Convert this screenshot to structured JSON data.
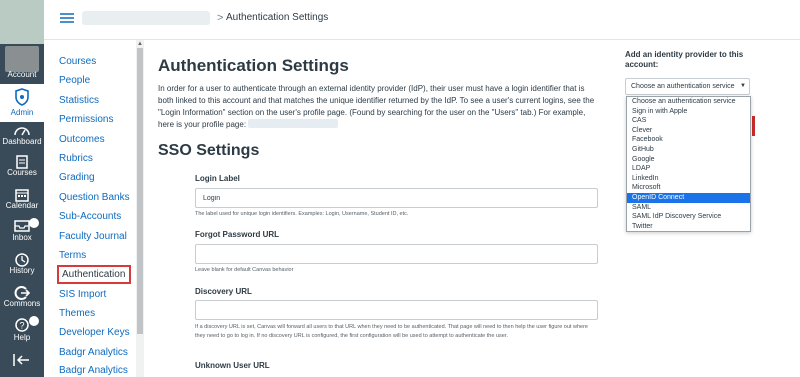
{
  "global_nav": {
    "account": "Account",
    "admin": "Admin",
    "dashboard": "Dashboard",
    "courses": "Courses",
    "calendar": "Calendar",
    "inbox": "Inbox",
    "history": "History",
    "commons": "Commons",
    "help": "Help",
    "active_color": "#0e6bbf"
  },
  "header": {
    "breadcrumb_current": "Authentication Settings",
    "separator": ">"
  },
  "course_nav": {
    "items": [
      "Courses",
      "People",
      "Statistics",
      "Permissions",
      "Outcomes",
      "Rubrics",
      "Grading",
      "Question Banks",
      "Sub-Accounts",
      "Faculty Journal",
      "Terms",
      "Authentication",
      "SIS Import",
      "Themes",
      "Developer Keys",
      "Badgr Analytics",
      "Badgr Analytics"
    ],
    "selected": "Authentication"
  },
  "main": {
    "title": "Authentication Settings",
    "intro": "In order for a user to authenticate through an external identity provider (IdP), their user must have a login identifier that is both linked to this account and that matches the unique identifier returned by the IdP. To see a user's current logins, see the \"Login Information\" section on the user's profile page. (Found by searching for the user on the \"Users\" tab.) For example, here is your profile page:",
    "sso_title": "SSO Settings",
    "login_label": {
      "label": "Login Label",
      "value": "Login",
      "help": "The label used for unique login identifiers. Examples: Login, Username, Student ID, etc."
    },
    "forgot_password": {
      "label": "Forgot Password URL",
      "value": "",
      "help": "Leave blank for default Canvas behavior"
    },
    "discovery": {
      "label": "Discovery URL",
      "value": "",
      "help": "If a discovery URL is set, Canvas will forward all users to that URL when they need to be authenticated. That page will need to then help the user figure out where they need to go to log in. If no discovery URL is configured, the first configuration will be used to attempt to authenticate the user."
    },
    "unknown_user": {
      "label": "Unknown User URL"
    }
  },
  "side": {
    "title": "Add an identity provider to this account:",
    "selected": "Choose an authentication service",
    "options": [
      "Choose an authentication service",
      "Sign in with Apple",
      "CAS",
      "Clever",
      "Facebook",
      "GitHub",
      "Google",
      "LDAP",
      "LinkedIn",
      "Microsoft",
      "OpenID Connect",
      "SAML",
      "SAML IdP Discovery Service",
      "Twitter"
    ],
    "highlighted": "OpenID Connect",
    "highlight_color": "#1a73e8"
  }
}
